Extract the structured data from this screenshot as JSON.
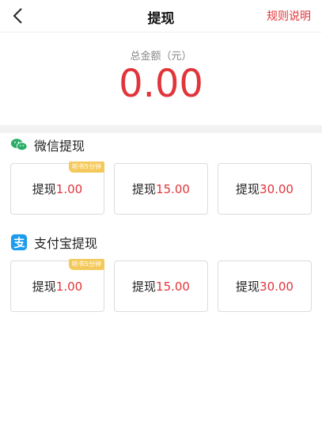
{
  "header": {
    "title": "提现",
    "rules_label": "规则说明"
  },
  "balance": {
    "label": "总金额（元）",
    "amount": "0.00"
  },
  "sections": [
    {
      "title": "微信提现",
      "icon": "wechat-icon",
      "options": [
        {
          "label": "提现",
          "amount": "1.00",
          "badge": "听书5分钟"
        },
        {
          "label": "提现",
          "amount": "15.00"
        },
        {
          "label": "提现",
          "amount": "30.00"
        }
      ]
    },
    {
      "title": "支付宝提现",
      "icon": "alipay-icon",
      "options": [
        {
          "label": "提现",
          "amount": "1.00",
          "badge": "听书5分钟"
        },
        {
          "label": "提现",
          "amount": "15.00"
        },
        {
          "label": "提现",
          "amount": "30.00"
        }
      ]
    }
  ],
  "colors": {
    "accent": "#e0353a",
    "badge": "#f4c95c",
    "wechat": "#2aae67",
    "alipay": "#1e9bed"
  }
}
